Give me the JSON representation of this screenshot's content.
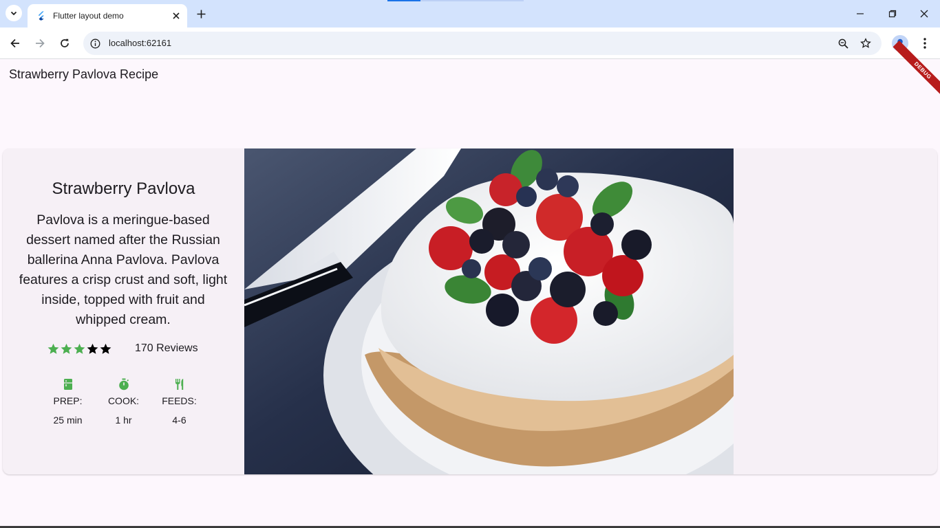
{
  "browser": {
    "tab_title": "Flutter layout demo",
    "url": "localhost:62161"
  },
  "app": {
    "appbar_title": "Strawberry Pavlova Recipe",
    "debug_banner": "DEBUG"
  },
  "recipe": {
    "title": "Strawberry Pavlova",
    "description": "Pavlova is a meringue-based dessert named after the Russian ballerina Anna Pavlova. Pavlova features a crisp crust and soft, light inside, topped with fruit and whipped cream.",
    "rating": {
      "stars_filled": 3,
      "stars_total": 5,
      "reviews": "170 Reviews"
    },
    "info": [
      {
        "icon": "kitchen-icon",
        "label": "PREP:",
        "value": "25 min"
      },
      {
        "icon": "timer-icon",
        "label": "COOK:",
        "value": "1 hr"
      },
      {
        "icon": "restaurant-icon",
        "label": "FEEDS:",
        "value": "4-6"
      }
    ]
  },
  "colors": {
    "accent_green": "#4caf50",
    "page_bg": "#fdf7fd",
    "card_bg": "#f6f0f6",
    "tabbar_bg": "#d3e3fd"
  }
}
